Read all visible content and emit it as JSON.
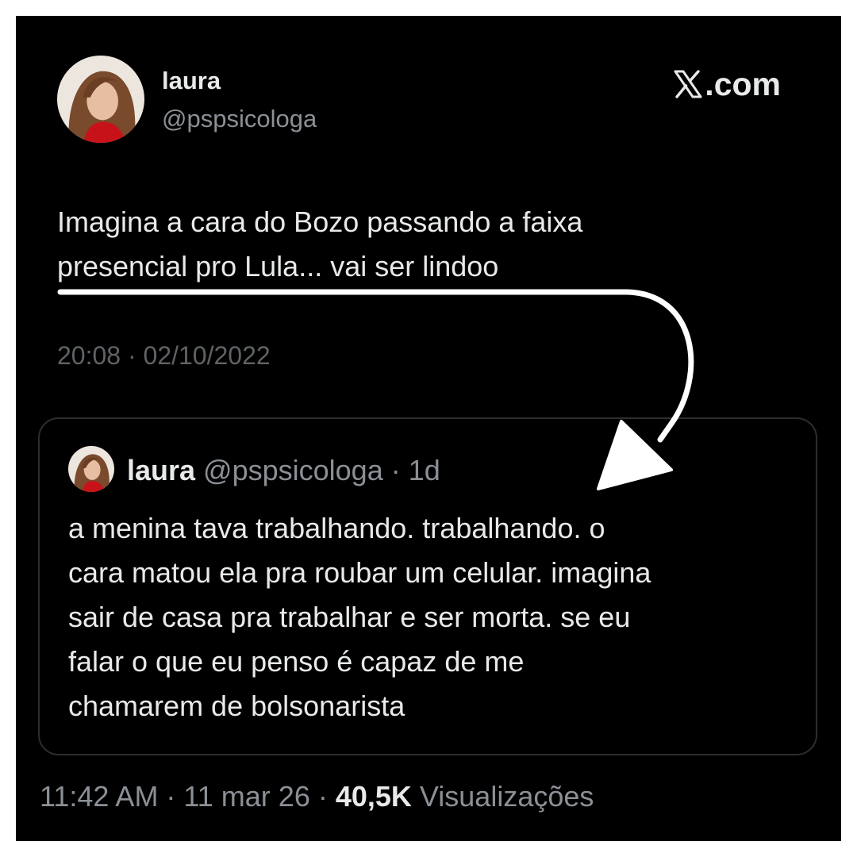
{
  "tweet": {
    "display_name": "laura",
    "handle": "@pspsicologa",
    "brand": ".com",
    "brand_icon": "x-logo-icon",
    "text": "Imagina a cara do Bozo passando a faixa\npresencial pro Lula... vai ser lindoo",
    "timestamp": "20:08 · 02/10/2022"
  },
  "quote": {
    "display_name": "laura",
    "handle_meta": " @pspsicologa · 1d",
    "text": "a menina tava trabalhando. trabalhando. o\ncara matou ela pra roubar um celular. imagina\nsair de casa pra trabalhar e ser morta. se eu\nfalar o que eu penso é capaz de me\nchamarem de bolsonarista"
  },
  "footer": {
    "time_date": "11:42 AM · 11 mar 26 · ",
    "views": "40,5K",
    "views_label": " Visualizações"
  },
  "colors": {
    "background": "#000000",
    "text": "#e7e9ea",
    "secondary": "#8b9096",
    "dim": "#5f6366",
    "border": "#2b2e31",
    "overlay_arrow": "#ffffff"
  }
}
